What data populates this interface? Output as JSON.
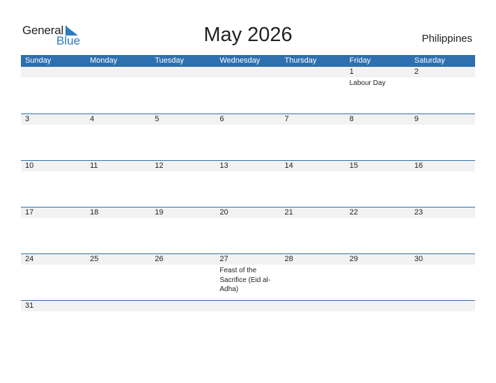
{
  "logo": {
    "line1": "General",
    "line2": "Blue",
    "icon": "blue-triangle-flag-icon"
  },
  "title": "May 2026",
  "country": "Philippines",
  "colors": {
    "accent": "#2e6faf",
    "band": "#f2f2f2"
  },
  "weekdays": [
    "Sunday",
    "Monday",
    "Tuesday",
    "Wednesday",
    "Thursday",
    "Friday",
    "Saturday"
  ],
  "weeks": [
    [
      {
        "day": ""
      },
      {
        "day": ""
      },
      {
        "day": ""
      },
      {
        "day": ""
      },
      {
        "day": ""
      },
      {
        "day": "1",
        "holiday": "Labour Day"
      },
      {
        "day": "2"
      }
    ],
    [
      {
        "day": "3"
      },
      {
        "day": "4"
      },
      {
        "day": "5"
      },
      {
        "day": "6"
      },
      {
        "day": "7"
      },
      {
        "day": "8"
      },
      {
        "day": "9"
      }
    ],
    [
      {
        "day": "10"
      },
      {
        "day": "11"
      },
      {
        "day": "12"
      },
      {
        "day": "13"
      },
      {
        "day": "14"
      },
      {
        "day": "15"
      },
      {
        "day": "16"
      }
    ],
    [
      {
        "day": "17"
      },
      {
        "day": "18"
      },
      {
        "day": "19"
      },
      {
        "day": "20"
      },
      {
        "day": "21"
      },
      {
        "day": "22"
      },
      {
        "day": "23"
      }
    ],
    [
      {
        "day": "24"
      },
      {
        "day": "25"
      },
      {
        "day": "26"
      },
      {
        "day": "27",
        "holiday": "Feast of the Sacrifice (Eid al-Adha)"
      },
      {
        "day": "28"
      },
      {
        "day": "29"
      },
      {
        "day": "30"
      }
    ],
    [
      {
        "day": "31"
      },
      {
        "day": ""
      },
      {
        "day": ""
      },
      {
        "day": ""
      },
      {
        "day": ""
      },
      {
        "day": ""
      },
      {
        "day": ""
      }
    ]
  ]
}
